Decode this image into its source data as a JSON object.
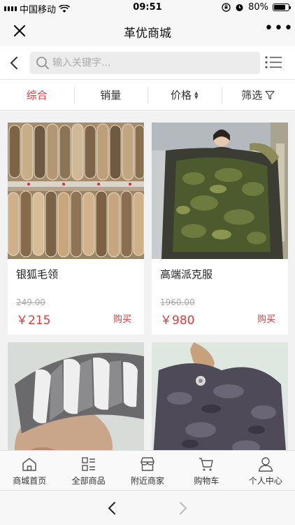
{
  "status_bar": {
    "carrier": "中国移动",
    "time": "09:51",
    "battery": "80%",
    "icons": [
      "signal-icon",
      "wifi-icon",
      "rotation-lock-icon",
      "alarm-icon",
      "battery-icon"
    ]
  },
  "titlebar": {
    "title": "革优商城",
    "more_label": "•••",
    "icons": [
      "close-icon",
      "more-icon"
    ]
  },
  "search": {
    "placeholder": "输入关键字...",
    "icons": [
      "back-arrow-icon",
      "search-icon",
      "list-view-icon"
    ]
  },
  "tabs": [
    {
      "label": "综合",
      "active": true
    },
    {
      "label": "销量",
      "active": false
    },
    {
      "label": "价格",
      "active": false,
      "icon": "sort-arrows-icon"
    },
    {
      "label": "筛选",
      "active": false,
      "icon": "filter-icon"
    }
  ],
  "products": [
    {
      "name": "银狐毛领",
      "old_price": "249.00",
      "price": "￥215",
      "buy": "购买"
    },
    {
      "name": "高端派克服",
      "old_price": "1960.00",
      "price": "￥980",
      "buy": "购买"
    },
    {
      "name": "",
      "old_price": "",
      "price": "",
      "buy": ""
    },
    {
      "name": "",
      "old_price": "",
      "price": "",
      "buy": ""
    }
  ],
  "bottom_nav": [
    {
      "label": "商城首页",
      "icon": "home-icon"
    },
    {
      "label": "全部商品",
      "icon": "category-list-icon"
    },
    {
      "label": "附近商家",
      "icon": "store-icon"
    },
    {
      "label": "购物车",
      "icon": "cart-icon"
    },
    {
      "label": "个人中心",
      "icon": "user-icon"
    }
  ],
  "browser_bar": {
    "icons": [
      "browser-back-icon",
      "browser-forward-icon"
    ]
  },
  "colors": {
    "accent": "#e0393e",
    "background": "#f2f2f2",
    "muted": "#aaaaaa"
  }
}
